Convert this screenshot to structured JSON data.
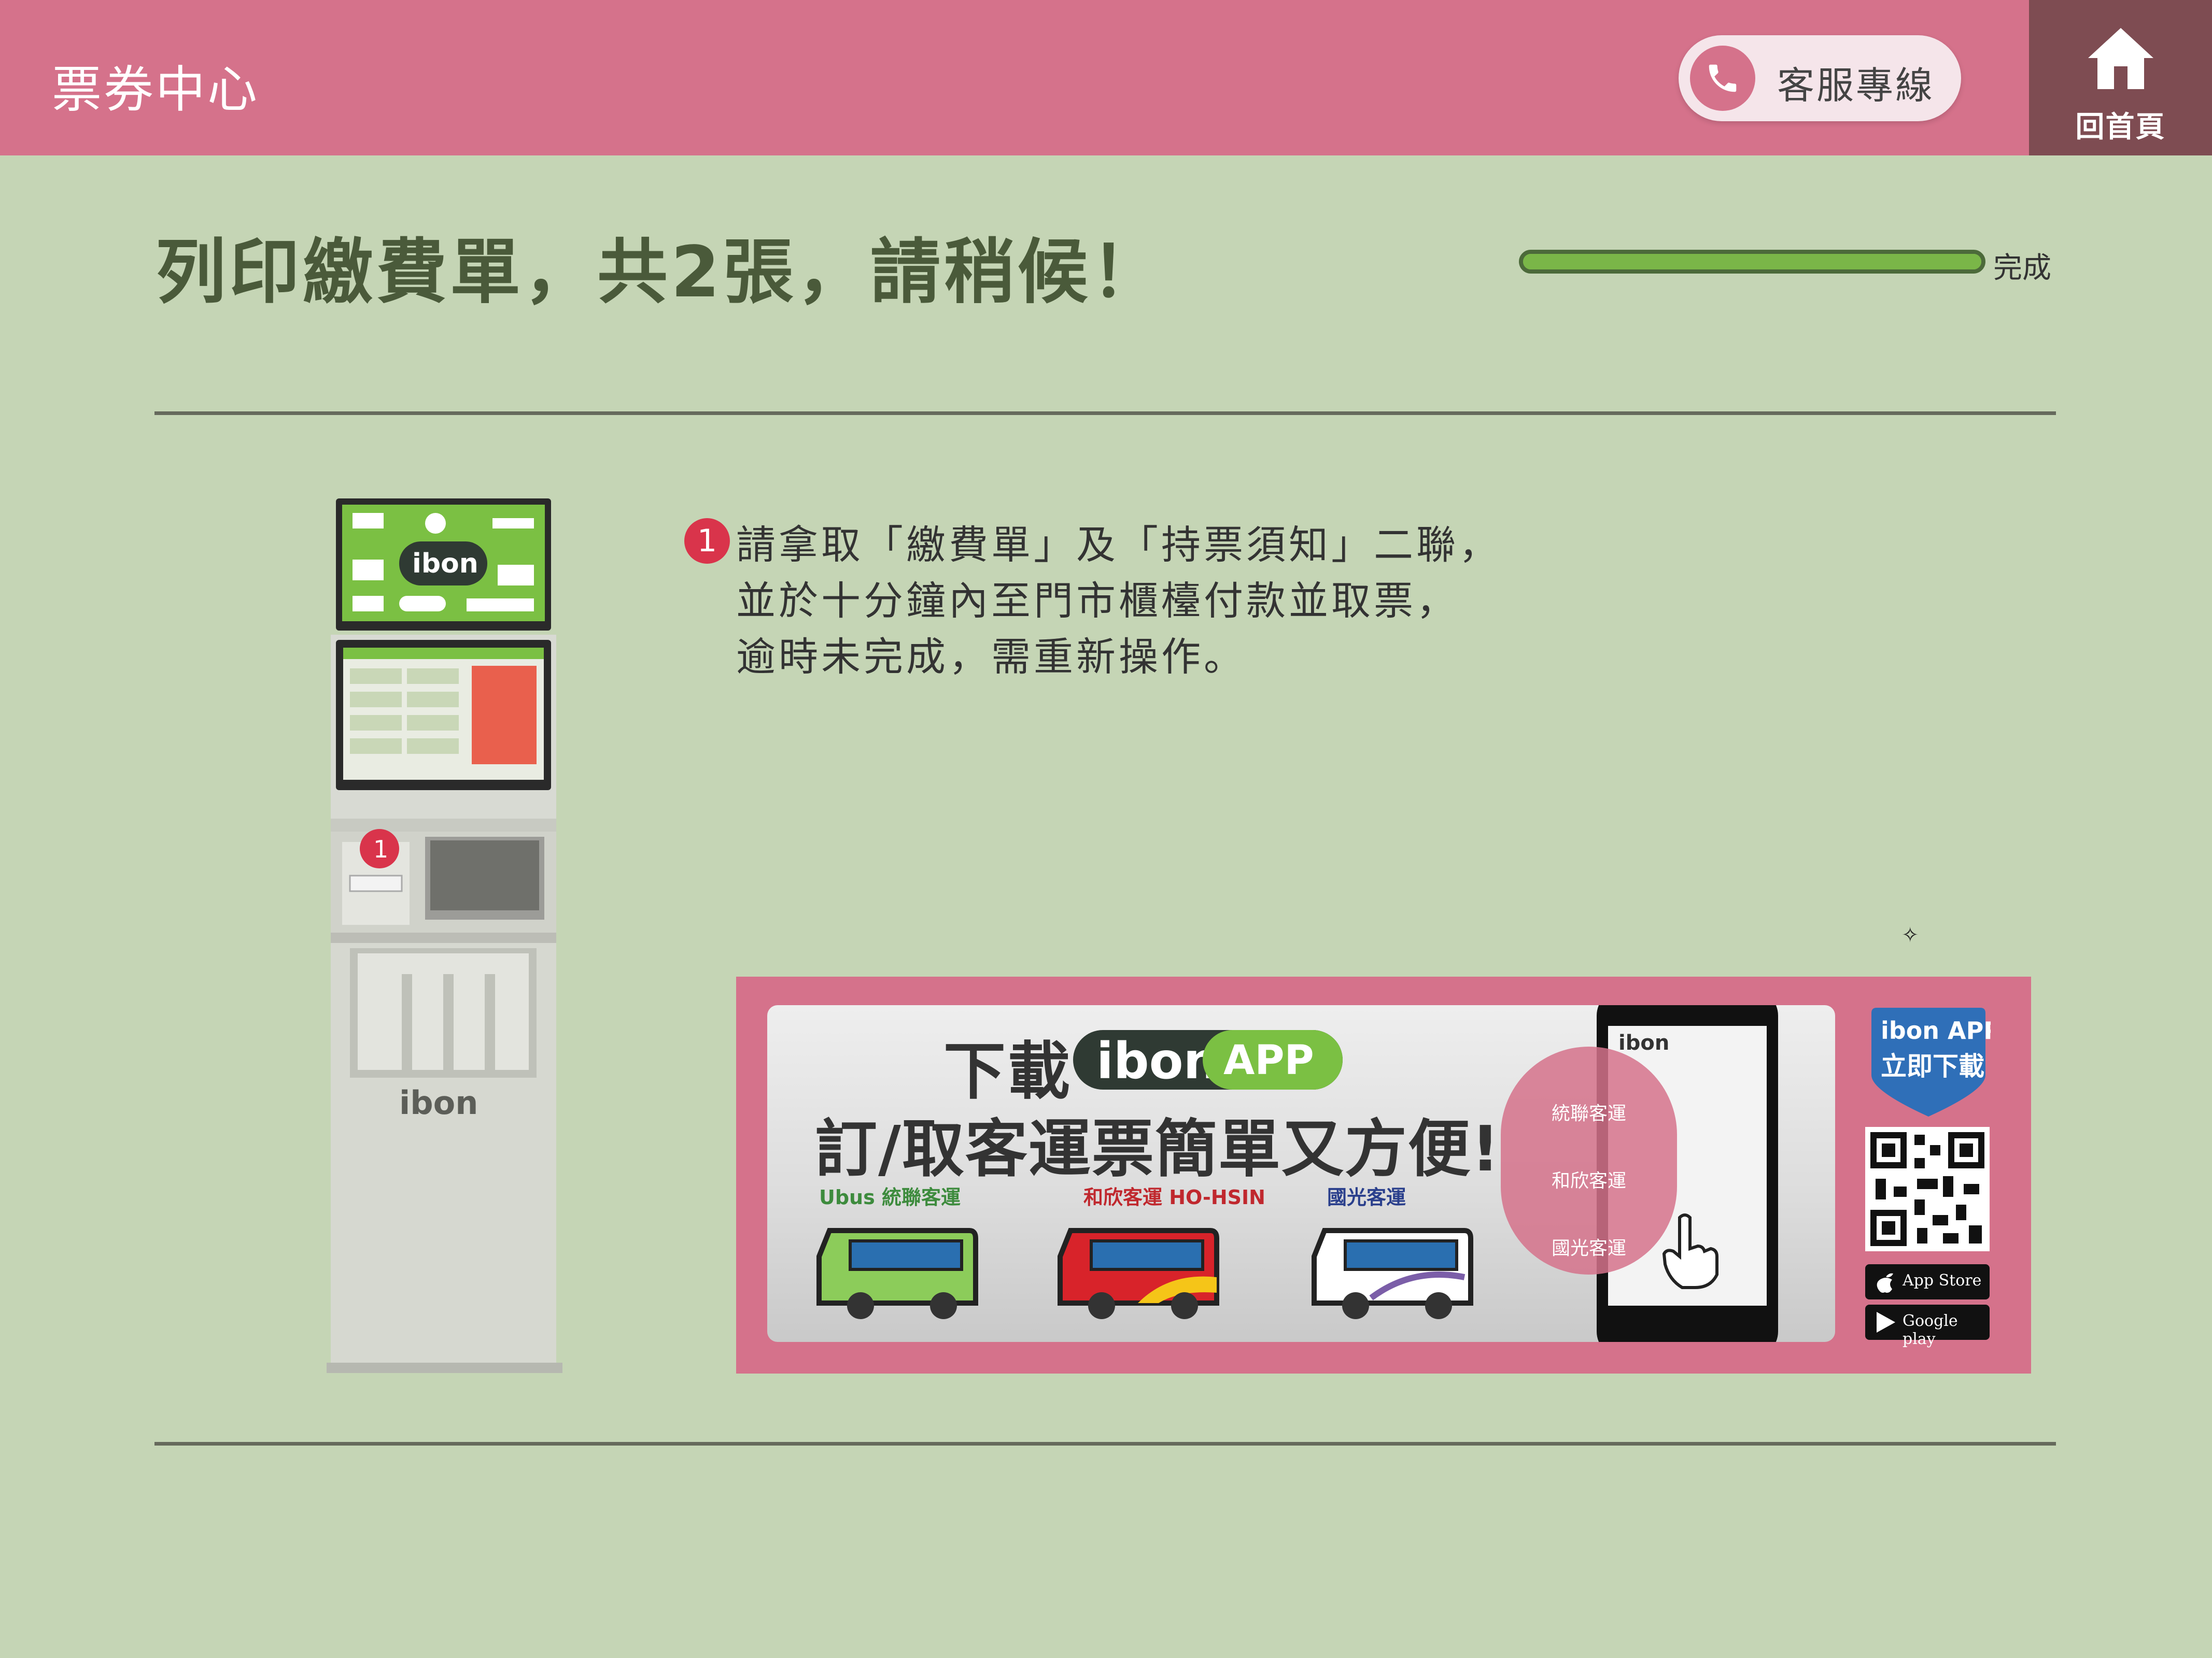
{
  "header": {
    "title": "票券中心",
    "service_label": "客服專線",
    "home_label": "回首頁"
  },
  "status": {
    "title": "列印繳費單，共2張，請稍候！",
    "progress_label": "完成",
    "progress_fraction": 1.0
  },
  "kiosk": {
    "brand": "ibon",
    "step_marker": "1"
  },
  "instruction": {
    "step": "1",
    "lines": [
      "請拿取「繳費單」及「持票須知」二聯，",
      "並於十分鐘內至門市櫃檯付款並取票，",
      "逾時未完成，需重新操作。"
    ]
  },
  "banner": {
    "line1_prefix": "下載",
    "ibon": "ibon",
    "app": "APP",
    "line2": "訂/取客運票簡單又方便!",
    "brands": [
      "Ubus 統聯客運",
      "和欣客運 HO-HSIN",
      "國光客運"
    ],
    "menu_items": [
      "統聯客運",
      "和欣客運",
      "國光客運"
    ],
    "phone_header": "ibon",
    "shield_line1": "ibon APP",
    "shield_line2": "立即下載",
    "app_store": "App Store",
    "google_play": "Google play"
  },
  "colors": {
    "header": "#d5728b",
    "home": "#7e4c52",
    "background": "#c5d5b5",
    "progress": "#7ab648",
    "accent_red": "#d9344b"
  }
}
